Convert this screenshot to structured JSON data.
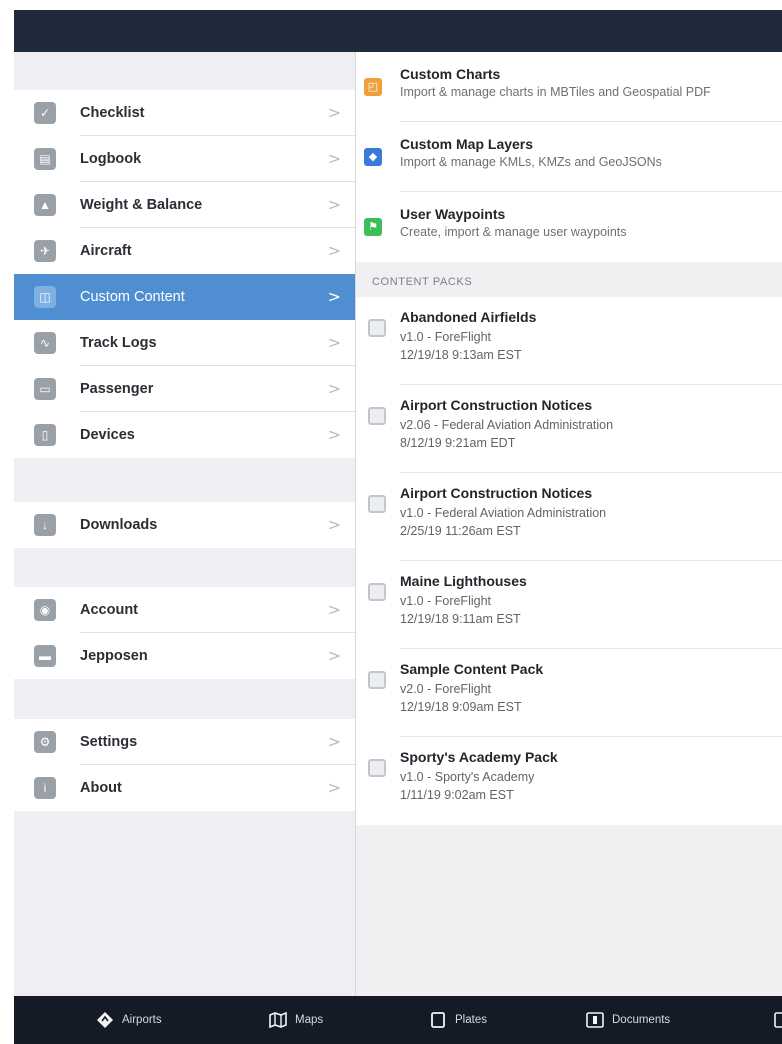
{
  "sidebar": {
    "group1": [
      {
        "label": "Checklist",
        "icon": "checkmark-icon"
      },
      {
        "label": "Logbook",
        "icon": "logbook-icon"
      },
      {
        "label": "Weight & Balance",
        "icon": "scale-icon"
      },
      {
        "label": "Aircraft",
        "icon": "airplane-icon"
      },
      {
        "label": "Custom Content",
        "icon": "custom-content-icon",
        "selected": true
      },
      {
        "label": "Track Logs",
        "icon": "track-log-icon"
      },
      {
        "label": "Passenger",
        "icon": "passenger-screen-icon"
      },
      {
        "label": "Devices",
        "icon": "device-icon"
      }
    ],
    "group2": [
      {
        "label": "Downloads",
        "icon": "download-icon"
      }
    ],
    "group3": [
      {
        "label": "Account",
        "icon": "account-icon"
      },
      {
        "label": "Jepposen",
        "icon": "jeppesen-icon"
      }
    ],
    "group4": [
      {
        "label": "Settings",
        "icon": "settings-icon"
      },
      {
        "label": "About",
        "icon": "info-icon"
      }
    ],
    "chevron": ">"
  },
  "content": {
    "custom_items": [
      {
        "title": "Custom Charts",
        "subtitle": "Import & manage charts in MBTiles and Geospatial PDF",
        "icon": "charts-icon",
        "color": "#f0a03a"
      },
      {
        "title": "Custom Map Layers",
        "subtitle": "Import & manage KMLs, KMZs and GeoJSONs",
        "icon": "map-layers-icon",
        "color": "#3a7ad8"
      },
      {
        "title": "User Waypoints",
        "subtitle": "Create, import & manage user waypoints",
        "icon": "flag-icon",
        "color": "#3cbf5a"
      }
    ],
    "section_label": "CONTENT PACKS",
    "packs": [
      {
        "title": "Abandoned Airfields",
        "version": "v1.0 - ForeFlight",
        "date": "12/19/18 9:13am EST"
      },
      {
        "title": "Airport Construction Notices",
        "version": "v2.06 - Federal Aviation Administration",
        "date": "8/12/19 9:21am EDT"
      },
      {
        "title": "Airport Construction Notices",
        "version": "v1.0 - Federal Aviation Administration",
        "date": "2/25/19 11:26am EST"
      },
      {
        "title": "Maine Lighthouses",
        "version": "v1.0 - ForeFlight",
        "date": "12/19/18 9:11am EST"
      },
      {
        "title": "Sample Content Pack",
        "version": "v2.0 - ForeFlight",
        "date": "12/19/18 9:09am EST"
      },
      {
        "title": "Sporty's Academy Pack",
        "version": "v1.0 - Sporty's Academy",
        "date": "1/11/19 9:02am EST"
      }
    ]
  },
  "tabs": [
    {
      "label": "Airports",
      "icon": "airports-diamond-icon"
    },
    {
      "label": "Maps",
      "icon": "maps-icon"
    },
    {
      "label": "Plates",
      "icon": "plates-icon"
    },
    {
      "label": "Documents",
      "icon": "documents-icon"
    }
  ],
  "colors": {
    "topbar": "#1f2a3d",
    "selected": "#4f8fd1",
    "tabbar": "#141b27"
  }
}
